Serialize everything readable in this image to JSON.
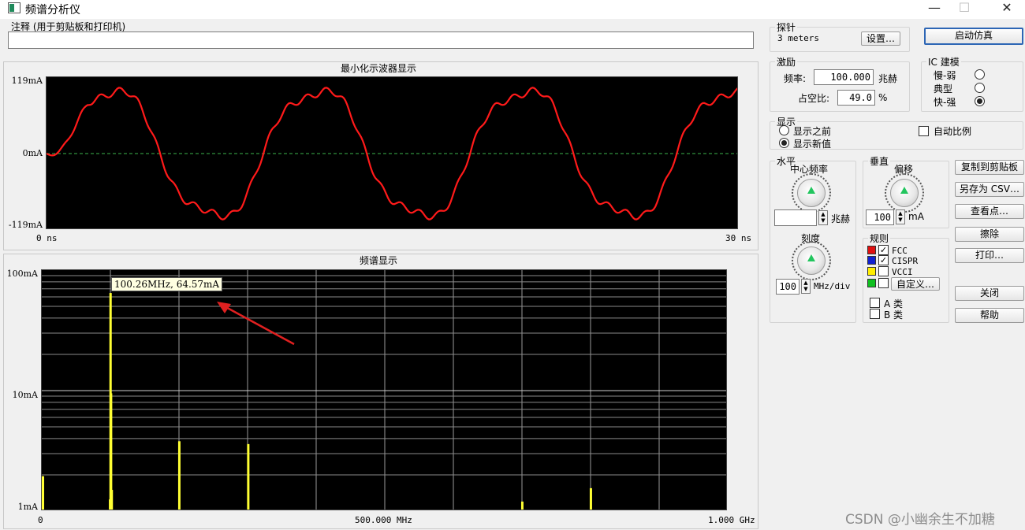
{
  "window": {
    "title": "频谱分析仪",
    "minimize": "—",
    "maximize": "☐",
    "close": "✕"
  },
  "annotation": {
    "label": "注释 (用于剪贴板和打印机)",
    "value": ""
  },
  "waveform": {
    "title": "最小化示波器显示",
    "y_top": "119mA",
    "y_mid": "0mA",
    "y_bottom": "-119mA",
    "x_start": "0 ns",
    "x_end": "30 ns",
    "trace_color": "#ff1a1a",
    "zero_line_color": "#3cb44b"
  },
  "spectrum": {
    "title": "频谱显示",
    "y_top": "100mA",
    "y_mid": "10mA",
    "y_bottom": "1mA",
    "x_start": "0",
    "x_mid": "500.000 MHz",
    "x_end": "1.000 GHz",
    "bar_color": "#ffff33",
    "tooltip": "100.26MHz, 64.57mA"
  },
  "probe": {
    "legend": "探针",
    "value": "3 meters",
    "settings_button": "设置…"
  },
  "start_button": "启动仿真",
  "excitation": {
    "legend": "激励",
    "freq_label": "频率:",
    "freq_value": "100.000",
    "freq_unit": "兆赫",
    "duty_label": "占空比:",
    "duty_value": "49.0",
    "duty_unit": "%"
  },
  "ic_model": {
    "legend": "IC 建模",
    "options": [
      {
        "label": "慢-弱",
        "selected": false
      },
      {
        "label": "典型",
        "selected": false
      },
      {
        "label": "快-强",
        "selected": true
      }
    ]
  },
  "display": {
    "legend": "显示",
    "show_before": "显示之前",
    "show_before_selected": false,
    "show_new": "显示新值",
    "show_new_selected": true,
    "auto_scale": "自动比例",
    "auto_scale_checked": false
  },
  "horizontal": {
    "legend": "水平",
    "center_freq": "中心频率",
    "center_value": "",
    "center_unit": "兆赫",
    "scale": "刻度",
    "scale_value": "100",
    "scale_unit": "MHz/div"
  },
  "vertical": {
    "legend": "垂直",
    "offset": "偏移",
    "offset_value": "100",
    "offset_unit": "mA"
  },
  "rules": {
    "legend": "规则",
    "items": [
      {
        "label": "FCC",
        "color": "#e01010",
        "checked": true
      },
      {
        "label": "CISPR",
        "color": "#1020d0",
        "checked": true
      },
      {
        "label": "VCCI",
        "color": "#ffee00",
        "checked": false
      },
      {
        "label": "",
        "color": "#10c020",
        "checked": false
      }
    ],
    "custom_button": "自定义…",
    "class_a": "A 类",
    "class_b": "B 类"
  },
  "actions": {
    "copy": "复制到剪贴板",
    "save_csv": "另存为 CSV…",
    "view_points": "查看点…",
    "erase": "擦除",
    "print": "打印…",
    "close": "关闭",
    "help": "帮助"
  },
  "watermark": "CSDN @小幽余生不加糖"
}
